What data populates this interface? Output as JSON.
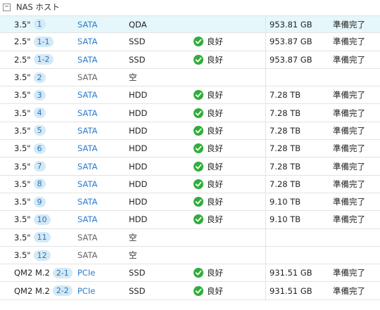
{
  "header": {
    "collapse_symbol": "−",
    "title": "NAS ホスト"
  },
  "rows": [
    {
      "slot": "3.5\"",
      "badge": "1",
      "iface": "SATA",
      "type": "QDA",
      "status": "",
      "capacity": "953.81 GB",
      "state": "準備完了"
    },
    {
      "slot": "2.5\"",
      "badge": "1-1",
      "iface": "SATA",
      "type": "SSD",
      "status": "良好",
      "capacity": "953.87 GB",
      "state": "準備完了"
    },
    {
      "slot": "2.5\"",
      "badge": "1-2",
      "iface": "SATA",
      "type": "SSD",
      "status": "良好",
      "capacity": "953.87 GB",
      "state": "準備完了"
    },
    {
      "slot": "3.5\"",
      "badge": "2",
      "iface": "SATA",
      "type": "空",
      "status": "",
      "capacity": "",
      "state": ""
    },
    {
      "slot": "3.5\"",
      "badge": "3",
      "iface": "SATA",
      "type": "HDD",
      "status": "良好",
      "capacity": "7.28 TB",
      "state": "準備完了"
    },
    {
      "slot": "3.5\"",
      "badge": "4",
      "iface": "SATA",
      "type": "HDD",
      "status": "良好",
      "capacity": "7.28 TB",
      "state": "準備完了"
    },
    {
      "slot": "3.5\"",
      "badge": "5",
      "iface": "SATA",
      "type": "HDD",
      "status": "良好",
      "capacity": "7.28 TB",
      "state": "準備完了"
    },
    {
      "slot": "3.5\"",
      "badge": "6",
      "iface": "SATA",
      "type": "HDD",
      "status": "良好",
      "capacity": "7.28 TB",
      "state": "準備完了"
    },
    {
      "slot": "3.5\"",
      "badge": "7",
      "iface": "SATA",
      "type": "HDD",
      "status": "良好",
      "capacity": "7.28 TB",
      "state": "準備完了"
    },
    {
      "slot": "3.5\"",
      "badge": "8",
      "iface": "SATA",
      "type": "HDD",
      "status": "良好",
      "capacity": "7.28 TB",
      "state": "準備完了"
    },
    {
      "slot": "3.5\"",
      "badge": "9",
      "iface": "SATA",
      "type": "HDD",
      "status": "良好",
      "capacity": "9.10 TB",
      "state": "準備完了"
    },
    {
      "slot": "3.5\"",
      "badge": "10",
      "iface": "SATA",
      "type": "HDD",
      "status": "良好",
      "capacity": "9.10 TB",
      "state": "準備完了"
    },
    {
      "slot": "3.5\"",
      "badge": "11",
      "iface": "SATA",
      "type": "空",
      "status": "",
      "capacity": "",
      "state": ""
    },
    {
      "slot": "3.5\"",
      "badge": "12",
      "iface": "SATA",
      "type": "空",
      "status": "",
      "capacity": "",
      "state": ""
    },
    {
      "slot": "QM2 M.2",
      "badge": "2-1",
      "iface": "PCIe",
      "type": "SSD",
      "status": "良好",
      "capacity": "931.51 GB",
      "state": "準備完了"
    },
    {
      "slot": "QM2 M.2",
      "badge": "2-2",
      "iface": "PCIe",
      "type": "SSD",
      "status": "良好",
      "capacity": "931.51 GB",
      "state": "準備完了"
    }
  ],
  "colors": {
    "ok_icon": "#2fae3b",
    "link": "#2b7bd0",
    "badge_bg": "#d3e9f6",
    "selected_row": "#e6f7fb"
  },
  "icons": {
    "status_ok": "check-circle-icon"
  }
}
